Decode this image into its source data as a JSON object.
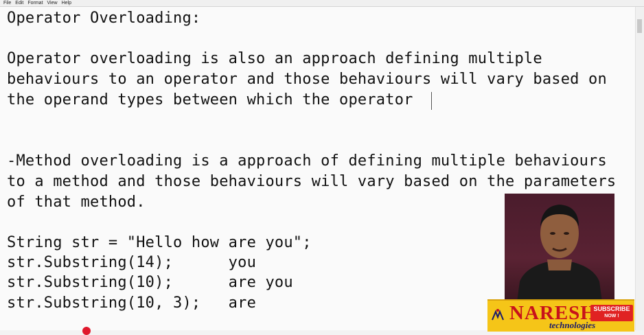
{
  "menu": [
    "File",
    "Edit",
    "Format",
    "View",
    "Help"
  ],
  "lines": [
    "Operator Overloading:",
    "Operator overloading is also an approach defining multiple",
    "behaviours to an operator and those behaviours will vary based on",
    "the operand types between which the operator",
    "-Method overloading is a approach of defining multiple behaviours",
    "to a method and those behaviours will vary based on the parameters",
    "of that method.",
    "String str = \"Hello how are you\";",
    "str.Substring(14);      you",
    "str.Substring(10);      are you",
    "str.Substring(10, 3);   are"
  ],
  "branding": {
    "name": "NARESH",
    "subtitle": "technologies",
    "logo_text": "NIT",
    "subscribe_line1": "SUBSCRIBE",
    "subscribe_line2": "NOW !"
  },
  "colors": {
    "brand_bg": "#f5c518",
    "brand_red": "#c8121a",
    "subscribe_red": "#e02222",
    "webcam_bg": "#4a1c2c"
  }
}
